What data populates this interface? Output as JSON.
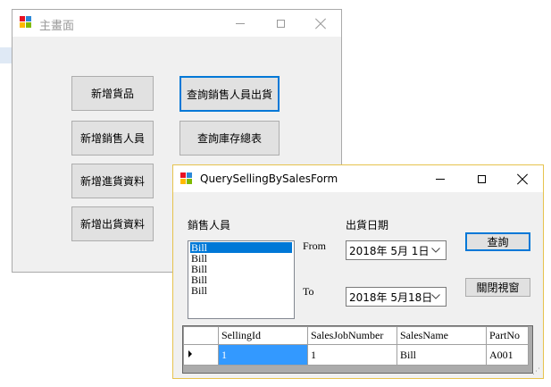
{
  "main_window": {
    "title": "主畫面",
    "buttons": {
      "add_goods": "新增貨品",
      "add_salesperson": "新增銷售人員",
      "add_purchase": "新增進貨資料",
      "add_shipment": "新增出貨資料",
      "query_salesperson_shipments": "查詢銷售人員出貨",
      "query_inventory_summary": "查詢庫存總表"
    }
  },
  "query_window": {
    "title": "QuerySellingBySalesForm",
    "salesperson_label": "銷售人員",
    "ship_date_label": "出貨日期",
    "from_label": "From",
    "to_label": "To",
    "salespersons": [
      "Bill",
      "Bill",
      "Bill",
      "Bill",
      "Bill"
    ],
    "selected_salesperson_index": 0,
    "from_date": "2018年  5月  1日",
    "to_date": "2018年  5月18日",
    "query_button": "查詢",
    "close_button": "關閉視窗",
    "grid": {
      "columns": [
        "SellingId",
        "SalesJobNumber",
        "SalesName",
        "PartNo"
      ],
      "rows": [
        {
          "SellingId": "1",
          "SalesJobNumber": "1",
          "SalesName": "Bill",
          "PartNo": "A001"
        }
      ]
    }
  },
  "colors": {
    "accent": "#0078d7",
    "selection": "#3399ff",
    "active_border": "#e6c34e"
  }
}
